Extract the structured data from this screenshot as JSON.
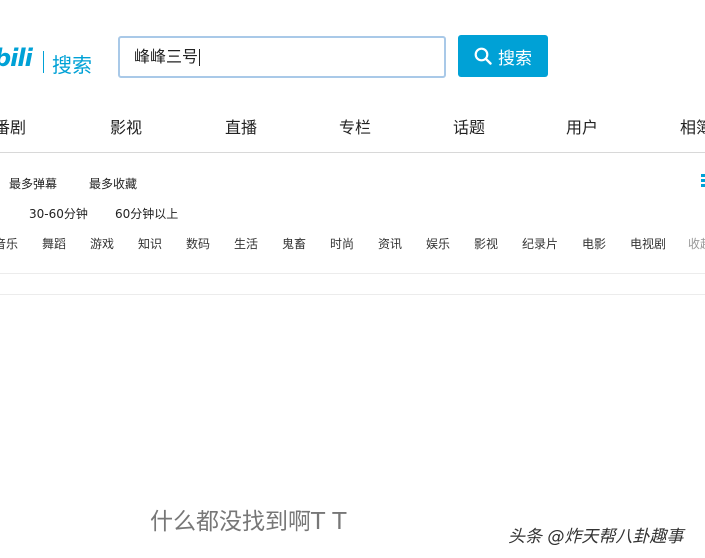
{
  "header": {
    "logo_text": "bili",
    "logo_subtitle": "搜索",
    "search_value": "峰峰三号",
    "search_button_label": "搜索",
    "search_icon": "search-icon"
  },
  "tabs": [
    "番剧",
    "影视",
    "直播",
    "专栏",
    "话题",
    "用户",
    "相簿"
  ],
  "filters": {
    "sort": [
      "最多弹幕",
      "最多收藏"
    ],
    "duration": [
      "30-60分钟",
      "60分钟以上"
    ],
    "categories": [
      "音乐",
      "舞蹈",
      "游戏",
      "知识",
      "数码",
      "生活",
      "鬼畜",
      "时尚",
      "资讯",
      "娱乐",
      "影视",
      "纪录片",
      "电影",
      "电视剧",
      "收起"
    ]
  },
  "empty_message": "什么都没找到啊T T",
  "watermark": "头条 @炸天帮八卦趣事",
  "colors": {
    "accent": "#00a1d6",
    "input_border": "#a9c9e8",
    "empty_text": "#777777"
  }
}
